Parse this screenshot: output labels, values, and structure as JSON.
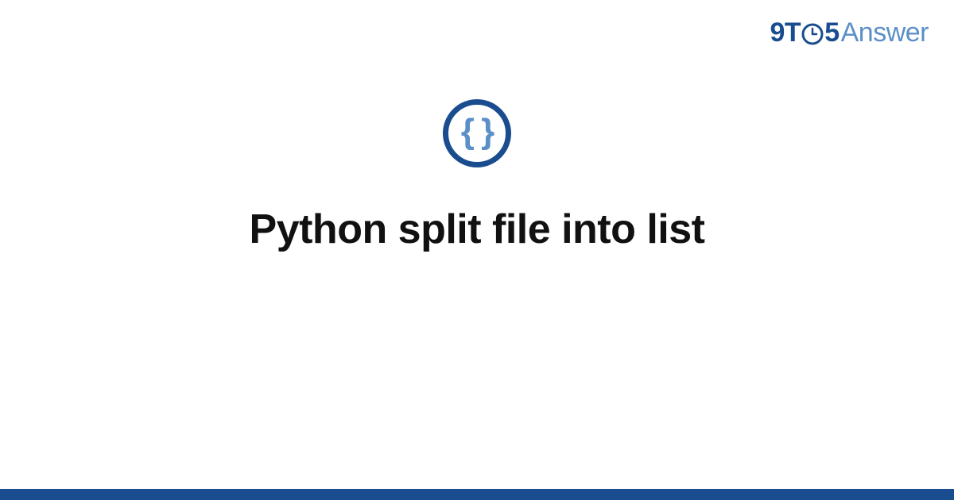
{
  "brand": {
    "part1": "9T",
    "part2": "5",
    "part3": "Answer"
  },
  "icon": {
    "name": "code-braces-icon",
    "glyph": "{ }"
  },
  "title": "Python split file into list",
  "colors": {
    "brand_dark": "#1a4d8f",
    "brand_light": "#5b8fc7",
    "text": "#111111",
    "background": "#ffffff"
  }
}
